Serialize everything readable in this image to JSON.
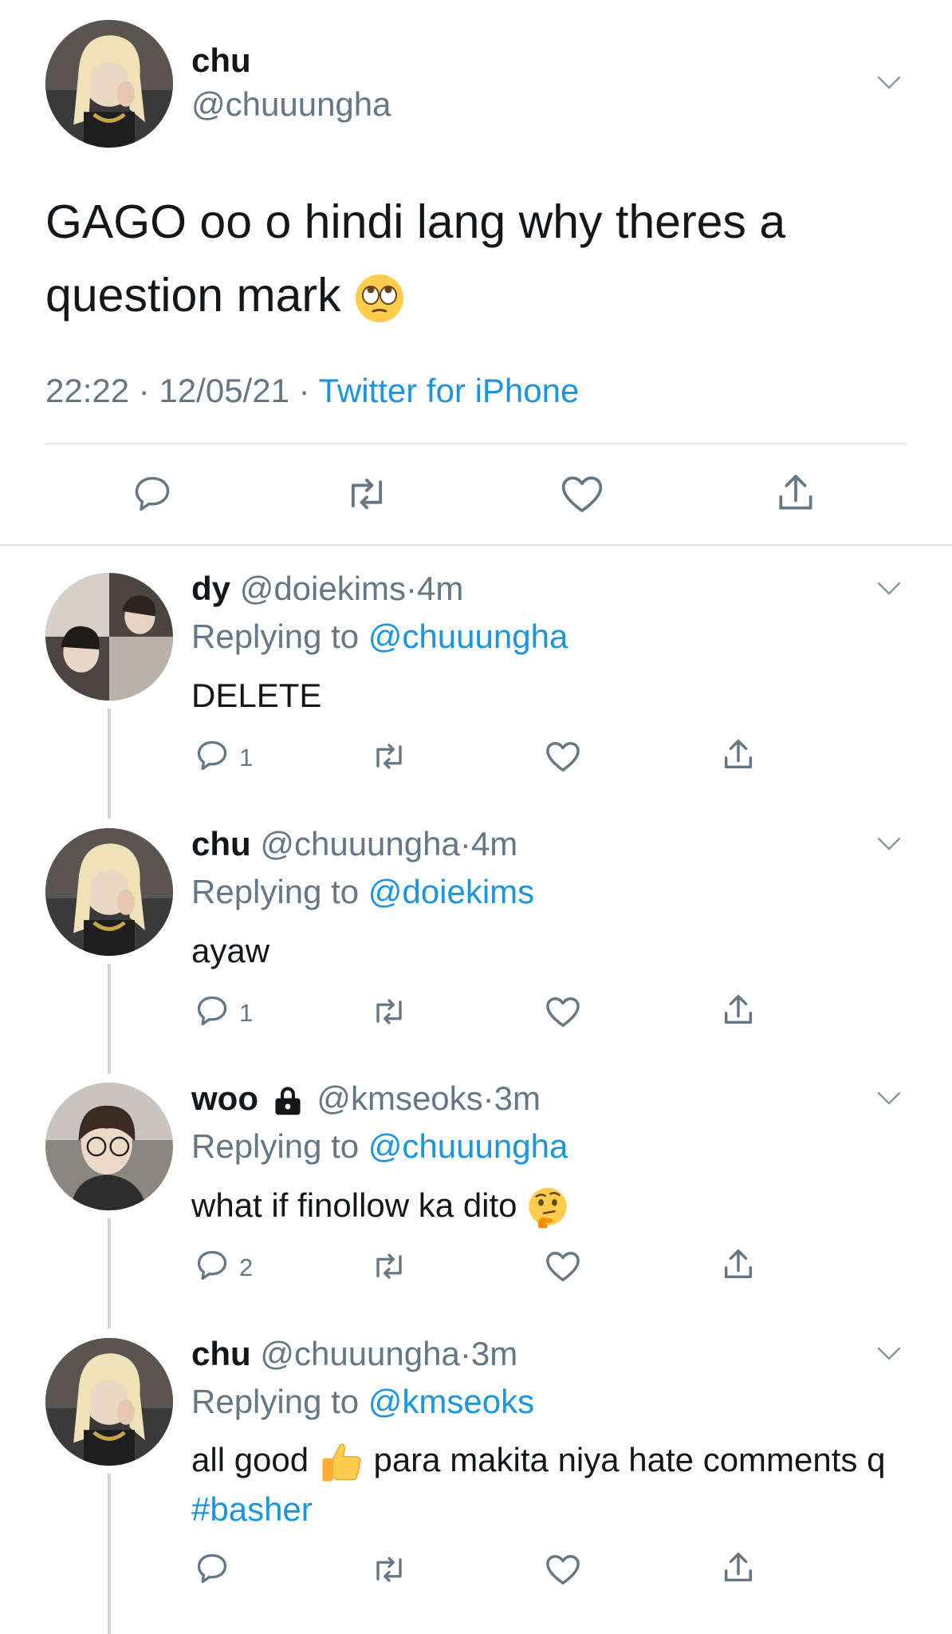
{
  "main_tweet": {
    "display_name": "chu",
    "handle": "@chuuungha",
    "text": "GAGO oo o hindi lang why theres a question mark",
    "emoji": "face-with-rolling-eyes",
    "time": "22:22",
    "date": "12/05/21",
    "source": "Twitter for iPhone",
    "separator": "·"
  },
  "replies": [
    {
      "display_name": "dy",
      "handle": "@doiekims",
      "time": "4m",
      "replying_label": "Replying to",
      "replying_to": "@chuuungha",
      "text": "DELETE",
      "reply_count": "1"
    },
    {
      "display_name": "chu",
      "handle": "@chuuungha",
      "time": "4m",
      "replying_label": "Replying to",
      "replying_to": "@doiekims",
      "text": "ayaw",
      "reply_count": "1"
    },
    {
      "display_name": "woo",
      "handle": "@kmseoks",
      "time": "3m",
      "protected_icon": "lock-icon",
      "replying_label": "Replying to",
      "replying_to": "@chuuungha",
      "text": "what if finollow ka dito",
      "emoji": "thinking-face",
      "reply_count": "2"
    },
    {
      "display_name": "chu",
      "handle": "@chuuungha",
      "time": "3m",
      "replying_label": "Replying to",
      "replying_to": "@kmseoks",
      "text_part1": "all good",
      "emoji": "thumbs-up",
      "text_part2": "para makita niya hate comments q",
      "hashtag": "#basher",
      "reply_count": ""
    }
  ],
  "colors": {
    "link": "#1b95e0",
    "secondary_text": "#657786",
    "divider": "#e1e8ed",
    "thread_line": "#ccd6dd"
  }
}
